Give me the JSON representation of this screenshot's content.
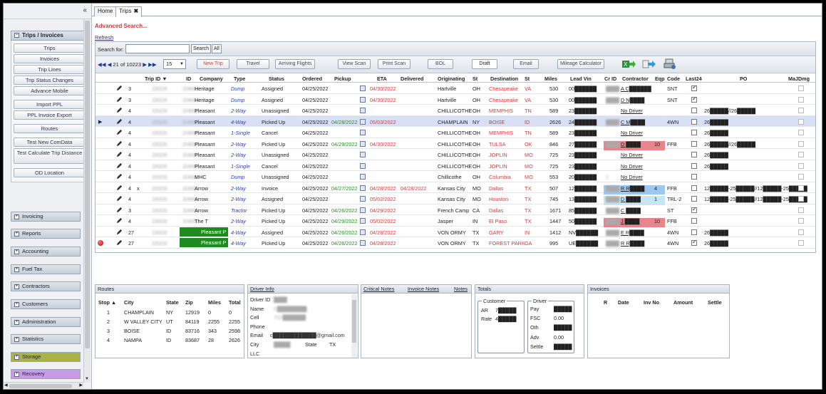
{
  "sidebar": {
    "collapse_glyph": "«",
    "section_title": "Trips / Invoices",
    "items": [
      "Trips",
      "Invoices",
      "Trip Lines",
      "Trip Status Changes",
      "Advance Mobile",
      "Import PPL",
      "PPL Invoice Export",
      "Routes",
      "Test New ComData",
      "Test Calculate Trip Distance",
      "OD Location"
    ],
    "groups": [
      "Invoicing",
      "Reports",
      "Accounting",
      "Fuel Tax",
      "Contractors",
      "Customers",
      "Administration",
      "Statistics",
      "Storage",
      "Recovery"
    ],
    "group_colors": {
      "Storage": "#a9b34a",
      "Recovery": "#c99ae8"
    }
  },
  "tabs": [
    {
      "label": "Home"
    },
    {
      "label": "Trips",
      "close": "✖"
    }
  ],
  "advanced_search": "Advanced Search...",
  "refresh": "Refresh",
  "search": {
    "label": "Search for:",
    "value": "",
    "search_btn": "Search",
    "all_btn": "All"
  },
  "toolbar": {
    "pager_first": "◀◀",
    "pager_prev": "◀",
    "pager_text": "21 of 10223",
    "pager_next": "▶",
    "pager_last": "▶▶",
    "page_size": "15",
    "new_trip": "New Trip",
    "travel": "Travel",
    "arriving_flights": "Arriving Flights",
    "view_scan": "View Scan",
    "print_scan": "Print Scan",
    "bol": "BOL",
    "draft": "Draft",
    "email": "Email",
    "mileage_calculator": "Mileage Calculator"
  },
  "columns": [
    "Trip ID ▼",
    "ID",
    "Company",
    "Type",
    "Status",
    "Ordered",
    "Pickup",
    "ETA",
    "Delivered",
    "Originating",
    "St",
    "Destination",
    "St",
    "Miles",
    "Lead Vin",
    "Cr ID",
    "Contractor",
    "Eqp",
    "Code",
    "Last24",
    "PO",
    "MaJDmg"
  ],
  "rows": [
    {
      "n": "3",
      "x": "",
      "tid": "220220",
      "id": "224000",
      "co": "Heritage",
      "type": "Dump",
      "status": "Assigned",
      "ord": "04/25/2022",
      "pick": "",
      "eta": "04/30/2022",
      "del": "",
      "orig": "Hartville",
      "ost": "OH",
      "dest": "Chesapeake",
      "dst": "VA",
      "miles": "530",
      "vin": "00██████",
      "crid": "████",
      "contr": "A C██████",
      "eqp": "",
      "code": "SNT",
      "last24": true,
      "po": "",
      "mark": ""
    },
    {
      "n": "3",
      "x": "",
      "tid": "220220",
      "id": "224000",
      "co": "Heritage",
      "type": "Dump",
      "status": "Assigned",
      "ord": "04/25/2022",
      "pick": "",
      "eta": "04/30/2022",
      "del": "",
      "orig": "Hartville",
      "ost": "OH",
      "dest": "Chesapeake",
      "dst": "VA",
      "miles": "530",
      "vin": "00██████",
      "crid": "████",
      "contr": "D N████",
      "eqp": "",
      "code": "SNT",
      "last24": true,
      "po": "",
      "mark": ""
    },
    {
      "n": "4",
      "x": "",
      "tid": "220220",
      "id": "224000",
      "co": "Pleasant",
      "type": "2-Way",
      "status": "Unassigned",
      "ord": "04/25/2022",
      "pick": "",
      "eta": "",
      "del": "",
      "orig": "CHILLICOTHE",
      "ost": "OH",
      "dest": "MEMPHIS",
      "dst": "TN",
      "miles": "589",
      "vin": "23██████",
      "crid": "",
      "contr": "No Driver",
      "eqp": "",
      "code": "",
      "last24": false,
      "po": "26█████//26█████",
      "mark": ""
    },
    {
      "n": "4",
      "x": "",
      "tid": "220220",
      "id": "224000",
      "co": "Pleasant",
      "type": "4-Way",
      "status": "Picked Up",
      "ord": "04/25/2022",
      "pick": "04/28/2022",
      "eta": "05/03/2022",
      "del": "",
      "orig": "CHAMPLAIN",
      "ost": "NY",
      "dest": "BOISE",
      "dst": "ID",
      "miles": "2626",
      "vin": "24██████",
      "crid": "████",
      "contr": "C M████",
      "eqp": "",
      "code": "4WN",
      "last24": false,
      "po": "26█████",
      "mark": "sel"
    },
    {
      "n": "4",
      "x": "",
      "tid": "220220",
      "id": "224000",
      "co": "Pleasant",
      "type": "1-Single",
      "status": "Cancel",
      "ord": "04/25/2022",
      "pick": "",
      "eta": "",
      "del": "",
      "orig": "CHILLICOTHE",
      "ost": "OH",
      "dest": "MEMPHIS",
      "dst": "TN",
      "miles": "589",
      "vin": "23██████",
      "crid": "",
      "contr": "No Driver",
      "eqp": "",
      "code": "",
      "last24": false,
      "po": "26█████",
      "mark": ""
    },
    {
      "n": "4",
      "x": "",
      "tid": "220220",
      "id": "224000",
      "co": "Pleasant",
      "type": "2-Way",
      "status": "Picked Up",
      "ord": "04/25/2022",
      "pick": "04/29/2022",
      "eta": "04/30/2022",
      "del": "",
      "orig": "CHILLICOTHE",
      "ost": "OH",
      "dest": "TULSA",
      "dst": "OK",
      "miles": "846",
      "vin": "27██████",
      "crid": "████",
      "contr": "D ████",
      "eqp": "10",
      "code": "FFB",
      "last24": false,
      "po": "26█████//26█████",
      "mark": "red"
    },
    {
      "n": "4",
      "x": "",
      "tid": "220220",
      "id": "224000",
      "co": "Pleasant",
      "type": "2-Way",
      "status": "Unassigned",
      "ord": "04/25/2022",
      "pick": "",
      "eta": "",
      "del": "",
      "orig": "CHILLICOTHE",
      "ost": "OH",
      "dest": "JOPLIN",
      "dst": "MO",
      "miles": "725",
      "vin": "23██████",
      "crid": "",
      "contr": "No Driver",
      "eqp": "",
      "code": "",
      "last24": false,
      "po": "26█████",
      "mark": ""
    },
    {
      "n": "4",
      "x": "",
      "tid": "220220",
      "id": "224000",
      "co": "Pleasant",
      "type": "1-Single",
      "status": "Cancel",
      "ord": "04/25/2022",
      "pick": "",
      "eta": "",
      "del": "",
      "orig": "CHILLICOTHE",
      "ost": "OH",
      "dest": "JOPLIN",
      "dst": "MO",
      "miles": "725",
      "vin": "23██████",
      "crid": "",
      "contr": "No Driver",
      "eqp": "",
      "code": "",
      "last24": false,
      "po": "26█████",
      "mark": ""
    },
    {
      "n": "4",
      "x": "",
      "tid": "220220",
      "id": "224000",
      "co": "MHC",
      "type": "Dump",
      "status": "Unassigned",
      "ord": "04/25/2022",
      "pick": "",
      "eta": "",
      "del": "",
      "orig": "Chillicothe",
      "ost": "OH",
      "dest": "Columbia",
      "dst": "MO",
      "miles": "553",
      "vin": "20██████",
      "crid": "1",
      "contr": "No Driver",
      "eqp": "",
      "code": "",
      "last24": false,
      "po": "",
      "mark": ""
    },
    {
      "n": "4",
      "x": "x",
      "tid": "220220",
      "id": "224000",
      "co": "Arrow",
      "type": "2-Way",
      "status": "Invoice",
      "ord": "04/25/2022",
      "pick": "04/27/2022",
      "eta": "04/28/2022",
      "del": "04/28/2022",
      "orig": "Kansas City",
      "ost": "MO",
      "dest": "Dallas",
      "dst": "TX",
      "miles": "507",
      "vin": "12██████",
      "crid": "████",
      "contr": "R R████",
      "eqp": "4",
      "code": "FFB",
      "last24": false,
      "po": "12█████-25█████//12█████-25█████",
      "mark": "blue"
    },
    {
      "n": "4",
      "x": "",
      "tid": "220220",
      "id": "224000",
      "co": "Arrow",
      "type": "2-Way",
      "status": "Assigned",
      "ord": "04/25/2022",
      "pick": "",
      "eta": "05/02/2022",
      "del": "",
      "orig": "Kansas City",
      "ost": "MO",
      "dest": "Houston",
      "dst": "TX",
      "miles": "745",
      "vin": "13██████",
      "crid": "████",
      "contr": "D ████",
      "eqp": "1",
      "code": "TRL-2",
      "last24": false,
      "po": "12█████-25█████//12█████-25█████",
      "mark": "lblue"
    },
    {
      "n": "3",
      "x": "",
      "tid": "220220",
      "id": "224000",
      "co": "Arrow",
      "type": "Tractor",
      "status": "Picked Up",
      "ord": "04/25/2022",
      "pick": "04/26/2022",
      "eta": "04/29/2022",
      "del": "",
      "orig": "French Camp",
      "ost": "CA",
      "dest": "Dallas",
      "dst": "TX",
      "miles": "1671",
      "vin": "85██████",
      "crid": "████",
      "contr": "C ████",
      "eqp": "",
      "code": "ST",
      "last24": true,
      "po": "",
      "mark": ""
    },
    {
      "n": "4",
      "x": "",
      "tid": "220220",
      "id": "224000",
      "co": "The T",
      "type": "2-Way",
      "status": "Picked Up",
      "ord": "04/25/2022",
      "pick": "04/29/2022",
      "eta": "05/02/2022",
      "del": "",
      "orig": "Jasper",
      "ost": "IN",
      "dest": "El Paso",
      "dst": "TX",
      "miles": "1447",
      "vin": "50██████",
      "crid": "████",
      "contr": "J ████",
      "eqp": "10",
      "code": "FFB",
      "last24": false,
      "po": "",
      "mark": "red"
    },
    {
      "n": "27",
      "x": "",
      "tid": "220220",
      "id": "224000",
      "co": "Pleasant P",
      "type": "4-Way",
      "status": "Assigned",
      "ord": "04/25/2022",
      "pick": "04/26/2022",
      "eta": "04/28/2022",
      "del": "",
      "orig": "VON ORMY",
      "ost": "TX",
      "dest": "GARY",
      "dst": "IN",
      "miles": "1412",
      "vin": "NV██████",
      "crid": "████",
      "contr": "E R████",
      "eqp": "",
      "code": "4WN",
      "last24": false,
      "po": "26█████",
      "mark": "green"
    },
    {
      "n": "27",
      "x": "",
      "tid": "220220",
      "id": "224000",
      "co": "Pleasant P",
      "type": "4-Way",
      "status": "Picked Up",
      "ord": "04/25/2022",
      "pick": "04/26/2022",
      "eta": "04/28/2022",
      "del": "",
      "orig": "VON ORMY",
      "ost": "TX",
      "dest": "FOREST PARK",
      "dst": "GA",
      "miles": "995",
      "vin": "UE██████",
      "crid": "████",
      "contr": "R R████",
      "eqp": "",
      "code": "4WN",
      "last24": true,
      "po": "26█████",
      "mark": "green-ball"
    }
  ],
  "routes": {
    "title": "Routes",
    "cols": [
      "Stop ▲",
      "City",
      "State",
      "Zip",
      "Miles",
      "Total"
    ],
    "rows": [
      [
        "1",
        "CHAMPLAIN",
        "NY",
        "12919",
        "0",
        "0"
      ],
      [
        "2",
        "W VALLEY CITY",
        "UT",
        "84119",
        "2255",
        "2255"
      ],
      [
        "3",
        "BOISE",
        "ID",
        "83716",
        "343",
        "2598"
      ],
      [
        "4",
        "NAMPA",
        "ID",
        "83687",
        "28",
        "2626"
      ]
    ]
  },
  "driver_info": {
    "title": "Driver Info",
    "labels": [
      "Driver ID",
      "Name",
      "Cell",
      "Phone",
      "Email",
      "City",
      "LLC"
    ],
    "values": [
      "████",
      "C█████████",
      "712-███████",
      "",
      "c████████████@gmail.com",
      "█████",
      ""
    ],
    "state_label": "State",
    "state_value": "TX"
  },
  "notes": {
    "critical": "Critical Notes",
    "invoice": "Invoice Notes",
    "notes": "Notes"
  },
  "totals": {
    "title": "Totals",
    "customer_legend": "Customer",
    "customer": [
      [
        "AR",
        "7█████"
      ],
      [
        "Rate",
        "4█████"
      ]
    ],
    "driver_legend": "Driver",
    "driver": [
      [
        "Pay",
        "█████"
      ],
      [
        "FSC",
        "0.00"
      ],
      [
        "Oth",
        "█████"
      ],
      [
        "Adv",
        "0.00"
      ],
      [
        "Settle",
        "█████"
      ]
    ]
  },
  "invoices": {
    "title": "Invoices",
    "cols": [
      "R",
      "Date",
      "Inv No",
      "Amount",
      "Settle"
    ]
  }
}
